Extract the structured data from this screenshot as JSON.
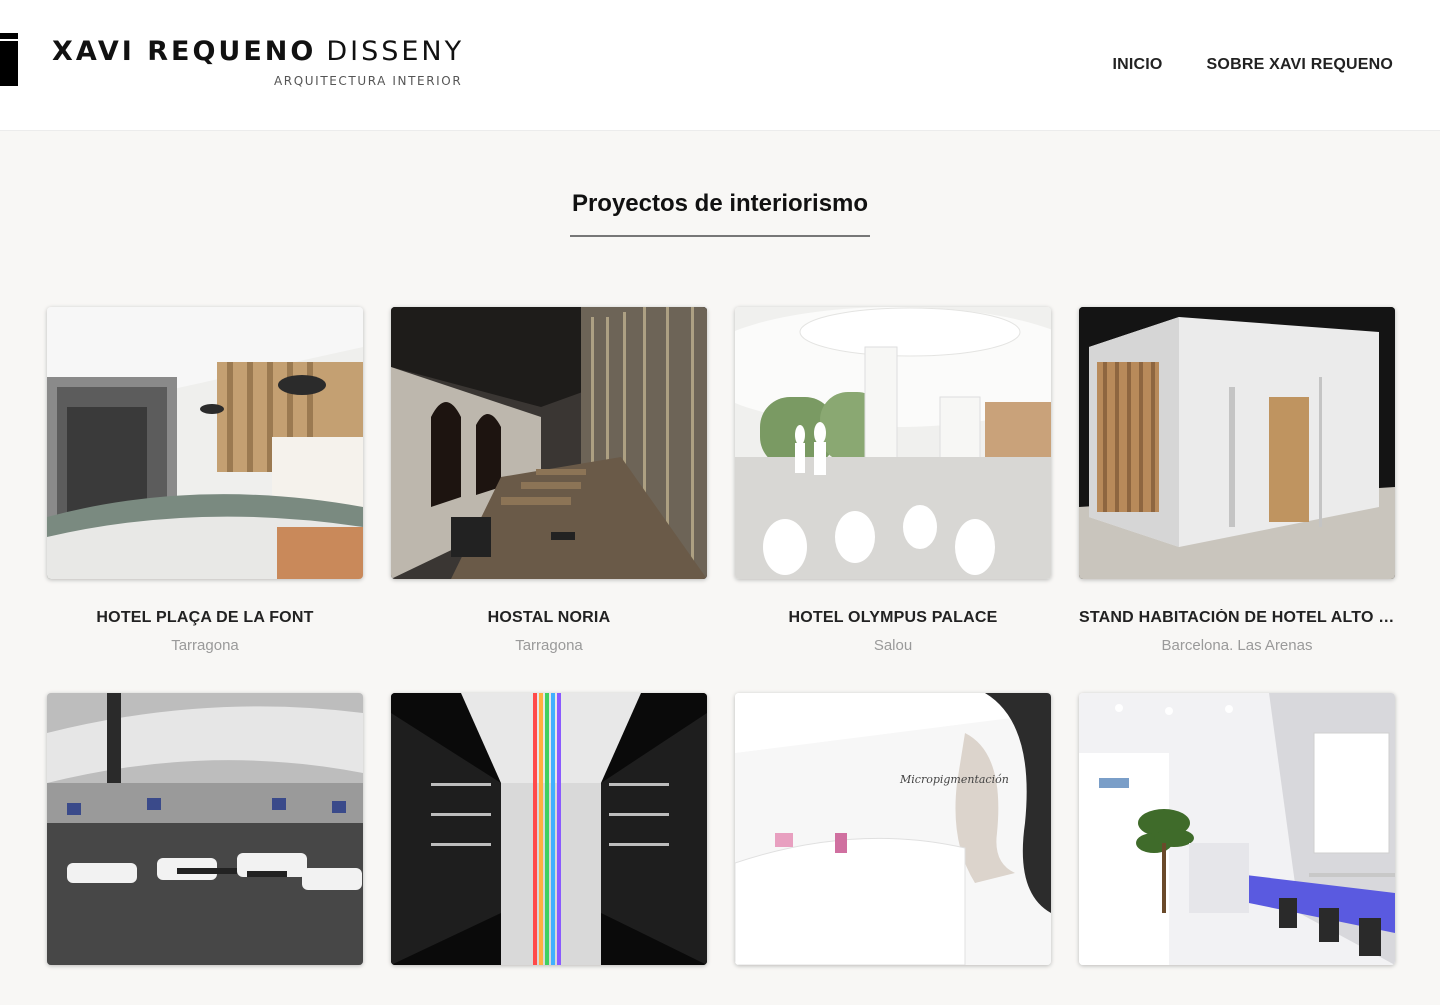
{
  "brand": {
    "name_bold": "XAVI REQUENO",
    "name_light": "DISSENY",
    "tagline": "ARQUITECTURA INTERIOR"
  },
  "nav": {
    "items": [
      {
        "label": "INICIO"
      },
      {
        "label": "SOBRE XAVI REQUENO"
      }
    ]
  },
  "section": {
    "title": "Proyectos de interiorismo"
  },
  "projects": [
    {
      "title": "HOTEL PLAÇA DE LA FONT",
      "location": "Tarragona"
    },
    {
      "title": "HOSTAL NORIA",
      "location": "Tarragona"
    },
    {
      "title": "HOTEL OLYMPUS PALACE",
      "location": "Salou"
    },
    {
      "title": "STAND HABITACIÓN DE HOTEL ALTO STA…",
      "location": "Barcelona. Las Arenas"
    },
    {
      "title": "",
      "location": ""
    },
    {
      "title": "",
      "location": ""
    },
    {
      "title": "",
      "location": ""
    },
    {
      "title": "",
      "location": ""
    }
  ],
  "thumb_texts": {
    "p7_script": "Micropigmentación"
  }
}
